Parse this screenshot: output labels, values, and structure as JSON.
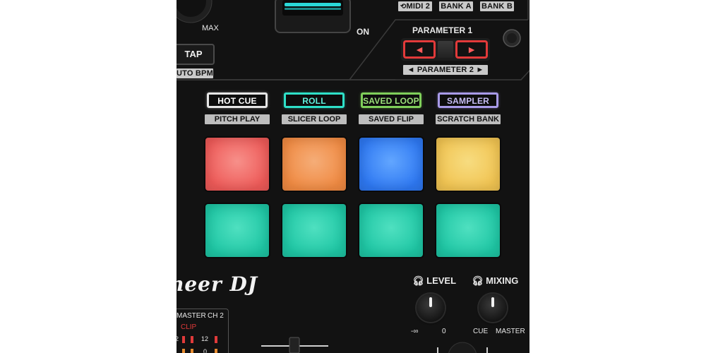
{
  "top": {
    "max_label": "MAX",
    "on_label": "ON",
    "tap_label": "TAP",
    "auto_bpm_label": "UTO BPM",
    "midi_label": "MIDI 2",
    "bank_a_label": "BANK A",
    "bank_b_label": "BANK B"
  },
  "parameter": {
    "title": "PARAMETER 1",
    "sub_label": "◄ PARAMETER 2 ►",
    "left_arrow": "◄",
    "right_arrow": "►"
  },
  "modes": [
    {
      "label": "HOT CUE",
      "sub": "PITCH PLAY",
      "color": "#e6e6e6",
      "text_color": "#ffffff"
    },
    {
      "label": "ROLL",
      "sub": "SLICER LOOP",
      "color": "#2ee0c8",
      "text_color": "#5ff0dc"
    },
    {
      "label": "SAVED LOOP",
      "sub": "SAVED FLIP",
      "color": "#7fcf5a",
      "text_color": "#9be07a"
    },
    {
      "label": "SAMPLER",
      "sub": "SCRATCH BANK",
      "color": "#a89ae8",
      "text_color": "#c7bdf5"
    }
  ],
  "pads": [
    {
      "color": "#ee5a58",
      "glow": "#f7908a"
    },
    {
      "color": "#f08a42",
      "glow": "#f5ad78"
    },
    {
      "color": "#2e78f2",
      "glow": "#62a6ff"
    },
    {
      "color": "#f1c452",
      "glow": "#f7dc80"
    },
    {
      "color": "#1ec6a4",
      "glow": "#4fe0c0"
    },
    {
      "color": "#1ec6a4",
      "glow": "#4fe0c0"
    },
    {
      "color": "#1ec6a4",
      "glow": "#4fe0c0"
    },
    {
      "color": "#1ec6a4",
      "glow": "#4fe0c0"
    }
  ],
  "brand": {
    "text": "neer DJ"
  },
  "headphones": {
    "level_label": "LEVEL",
    "level_min": "-∞",
    "level_max": "0",
    "mixing_label": "MIXING",
    "mixing_min": "CUE",
    "mixing_max": "MASTER"
  },
  "meter": {
    "master_label": "MASTER",
    "ch2_label": "CH 2",
    "clip_label": "CLIP",
    "scale_12": "12",
    "scale_2": "2",
    "scale_0": "0"
  },
  "colors": {
    "panel": "#121212",
    "clip": "#e03a3a",
    "arrow_button": "#e23a3a"
  }
}
